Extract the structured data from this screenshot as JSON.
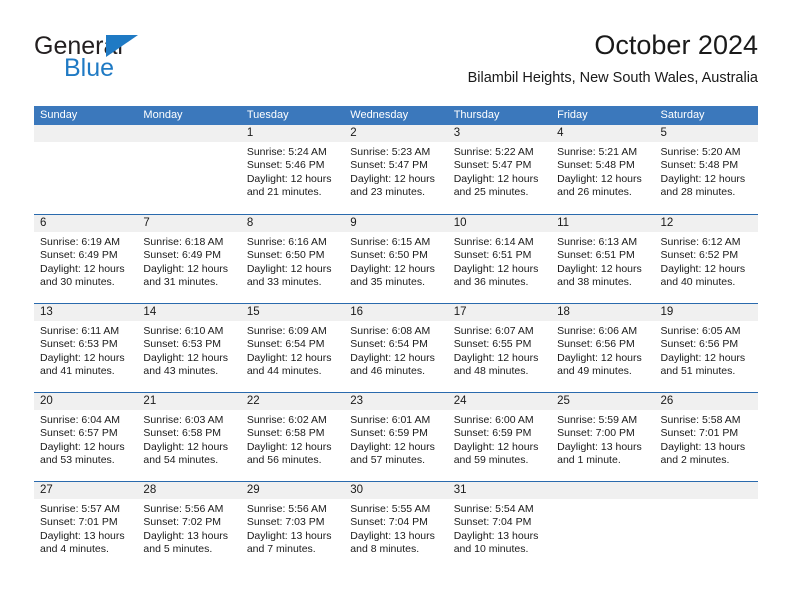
{
  "brand": {
    "name_part1": "General",
    "name_part2": "Blue",
    "accent_color": "#1f7ac4"
  },
  "header": {
    "title": "October 2024",
    "subtitle": "Bilambil Heights, New South Wales, Australia"
  },
  "theme": {
    "header_blue": "#3b78bc",
    "row_divider_blue": "#2a6aad",
    "day_band_gray": "#f0f0f0"
  },
  "labels": {
    "sunrise_prefix": "Sunrise:",
    "sunset_prefix": "Sunset:",
    "daylight_prefix": "Daylight:"
  },
  "day_headers": [
    "Sunday",
    "Monday",
    "Tuesday",
    "Wednesday",
    "Thursday",
    "Friday",
    "Saturday"
  ],
  "weeks": [
    [
      {
        "empty": true
      },
      {
        "empty": true
      },
      {
        "date": "1",
        "sunrise": "Sunrise: 5:24 AM",
        "sunset": "Sunset: 5:46 PM",
        "daylight_l1": "Daylight: 12 hours",
        "daylight_l2": "and 21 minutes."
      },
      {
        "date": "2",
        "sunrise": "Sunrise: 5:23 AM",
        "sunset": "Sunset: 5:47 PM",
        "daylight_l1": "Daylight: 12 hours",
        "daylight_l2": "and 23 minutes."
      },
      {
        "date": "3",
        "sunrise": "Sunrise: 5:22 AM",
        "sunset": "Sunset: 5:47 PM",
        "daylight_l1": "Daylight: 12 hours",
        "daylight_l2": "and 25 minutes."
      },
      {
        "date": "4",
        "sunrise": "Sunrise: 5:21 AM",
        "sunset": "Sunset: 5:48 PM",
        "daylight_l1": "Daylight: 12 hours",
        "daylight_l2": "and 26 minutes."
      },
      {
        "date": "5",
        "sunrise": "Sunrise: 5:20 AM",
        "sunset": "Sunset: 5:48 PM",
        "daylight_l1": "Daylight: 12 hours",
        "daylight_l2": "and 28 minutes."
      }
    ],
    [
      {
        "date": "6",
        "sunrise": "Sunrise: 6:19 AM",
        "sunset": "Sunset: 6:49 PM",
        "daylight_l1": "Daylight: 12 hours",
        "daylight_l2": "and 30 minutes."
      },
      {
        "date": "7",
        "sunrise": "Sunrise: 6:18 AM",
        "sunset": "Sunset: 6:49 PM",
        "daylight_l1": "Daylight: 12 hours",
        "daylight_l2": "and 31 minutes."
      },
      {
        "date": "8",
        "sunrise": "Sunrise: 6:16 AM",
        "sunset": "Sunset: 6:50 PM",
        "daylight_l1": "Daylight: 12 hours",
        "daylight_l2": "and 33 minutes."
      },
      {
        "date": "9",
        "sunrise": "Sunrise: 6:15 AM",
        "sunset": "Sunset: 6:50 PM",
        "daylight_l1": "Daylight: 12 hours",
        "daylight_l2": "and 35 minutes."
      },
      {
        "date": "10",
        "sunrise": "Sunrise: 6:14 AM",
        "sunset": "Sunset: 6:51 PM",
        "daylight_l1": "Daylight: 12 hours",
        "daylight_l2": "and 36 minutes."
      },
      {
        "date": "11",
        "sunrise": "Sunrise: 6:13 AM",
        "sunset": "Sunset: 6:51 PM",
        "daylight_l1": "Daylight: 12 hours",
        "daylight_l2": "and 38 minutes."
      },
      {
        "date": "12",
        "sunrise": "Sunrise: 6:12 AM",
        "sunset": "Sunset: 6:52 PM",
        "daylight_l1": "Daylight: 12 hours",
        "daylight_l2": "and 40 minutes."
      }
    ],
    [
      {
        "date": "13",
        "sunrise": "Sunrise: 6:11 AM",
        "sunset": "Sunset: 6:53 PM",
        "daylight_l1": "Daylight: 12 hours",
        "daylight_l2": "and 41 minutes."
      },
      {
        "date": "14",
        "sunrise": "Sunrise: 6:10 AM",
        "sunset": "Sunset: 6:53 PM",
        "daylight_l1": "Daylight: 12 hours",
        "daylight_l2": "and 43 minutes."
      },
      {
        "date": "15",
        "sunrise": "Sunrise: 6:09 AM",
        "sunset": "Sunset: 6:54 PM",
        "daylight_l1": "Daylight: 12 hours",
        "daylight_l2": "and 44 minutes."
      },
      {
        "date": "16",
        "sunrise": "Sunrise: 6:08 AM",
        "sunset": "Sunset: 6:54 PM",
        "daylight_l1": "Daylight: 12 hours",
        "daylight_l2": "and 46 minutes."
      },
      {
        "date": "17",
        "sunrise": "Sunrise: 6:07 AM",
        "sunset": "Sunset: 6:55 PM",
        "daylight_l1": "Daylight: 12 hours",
        "daylight_l2": "and 48 minutes."
      },
      {
        "date": "18",
        "sunrise": "Sunrise: 6:06 AM",
        "sunset": "Sunset: 6:56 PM",
        "daylight_l1": "Daylight: 12 hours",
        "daylight_l2": "and 49 minutes."
      },
      {
        "date": "19",
        "sunrise": "Sunrise: 6:05 AM",
        "sunset": "Sunset: 6:56 PM",
        "daylight_l1": "Daylight: 12 hours",
        "daylight_l2": "and 51 minutes."
      }
    ],
    [
      {
        "date": "20",
        "sunrise": "Sunrise: 6:04 AM",
        "sunset": "Sunset: 6:57 PM",
        "daylight_l1": "Daylight: 12 hours",
        "daylight_l2": "and 53 minutes."
      },
      {
        "date": "21",
        "sunrise": "Sunrise: 6:03 AM",
        "sunset": "Sunset: 6:58 PM",
        "daylight_l1": "Daylight: 12 hours",
        "daylight_l2": "and 54 minutes."
      },
      {
        "date": "22",
        "sunrise": "Sunrise: 6:02 AM",
        "sunset": "Sunset: 6:58 PM",
        "daylight_l1": "Daylight: 12 hours",
        "daylight_l2": "and 56 minutes."
      },
      {
        "date": "23",
        "sunrise": "Sunrise: 6:01 AM",
        "sunset": "Sunset: 6:59 PM",
        "daylight_l1": "Daylight: 12 hours",
        "daylight_l2": "and 57 minutes."
      },
      {
        "date": "24",
        "sunrise": "Sunrise: 6:00 AM",
        "sunset": "Sunset: 6:59 PM",
        "daylight_l1": "Daylight: 12 hours",
        "daylight_l2": "and 59 minutes."
      },
      {
        "date": "25",
        "sunrise": "Sunrise: 5:59 AM",
        "sunset": "Sunset: 7:00 PM",
        "daylight_l1": "Daylight: 13 hours",
        "daylight_l2": "and 1 minute."
      },
      {
        "date": "26",
        "sunrise": "Sunrise: 5:58 AM",
        "sunset": "Sunset: 7:01 PM",
        "daylight_l1": "Daylight: 13 hours",
        "daylight_l2": "and 2 minutes."
      }
    ],
    [
      {
        "date": "27",
        "sunrise": "Sunrise: 5:57 AM",
        "sunset": "Sunset: 7:01 PM",
        "daylight_l1": "Daylight: 13 hours",
        "daylight_l2": "and 4 minutes."
      },
      {
        "date": "28",
        "sunrise": "Sunrise: 5:56 AM",
        "sunset": "Sunset: 7:02 PM",
        "daylight_l1": "Daylight: 13 hours",
        "daylight_l2": "and 5 minutes."
      },
      {
        "date": "29",
        "sunrise": "Sunrise: 5:56 AM",
        "sunset": "Sunset: 7:03 PM",
        "daylight_l1": "Daylight: 13 hours",
        "daylight_l2": "and 7 minutes."
      },
      {
        "date": "30",
        "sunrise": "Sunrise: 5:55 AM",
        "sunset": "Sunset: 7:04 PM",
        "daylight_l1": "Daylight: 13 hours",
        "daylight_l2": "and 8 minutes."
      },
      {
        "date": "31",
        "sunrise": "Sunrise: 5:54 AM",
        "sunset": "Sunset: 7:04 PM",
        "daylight_l1": "Daylight: 13 hours",
        "daylight_l2": "and 10 minutes."
      },
      {
        "empty": true
      },
      {
        "empty": true
      }
    ]
  ]
}
